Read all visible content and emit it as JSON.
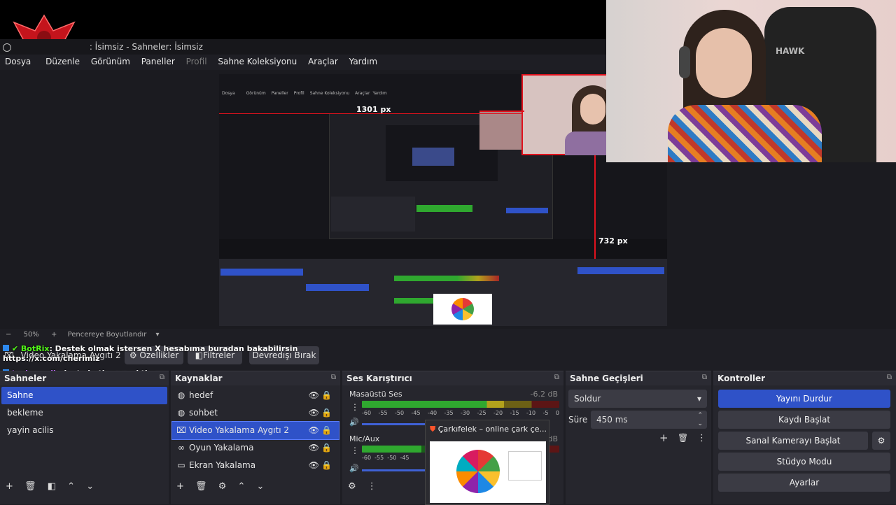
{
  "window": {
    "title": "OBS Studio - Profil: İsimsiz - Sahneler: İsimsiz",
    "title_visible": ": İsimsiz - Sahneler: İsimsiz"
  },
  "menu": [
    "Dosya",
    "Düzenle",
    "Görünüm",
    "Paneller",
    "Profil",
    "Sahne Koleksiyonu",
    "Araçlar",
    "Yardım"
  ],
  "preview": {
    "width_label": "1301 px",
    "height_label": "732 px",
    "zoom": "50%",
    "fit_label": "Pencereye Boyutlandır"
  },
  "chat": [
    {
      "user": "BotRix",
      "message": ": Destek olmak istersen X hesabıma buradan bakabilirsin"
    },
    {
      "user": "",
      "message": "https://x.com/cherimiz"
    },
    {
      "user": "technoerik",
      "message": ": just chating e cektim"
    }
  ],
  "toolbar": {
    "source_name": "Video Yakalama Aygıtı 2",
    "properties": "Özellikler",
    "filters": "Filtreler",
    "deactivate": "Devredışı Bırak"
  },
  "scenes": {
    "title": "Sahneler",
    "items": [
      "Sahne",
      "bekleme",
      "yayin acilis"
    ]
  },
  "sources": {
    "title": "Kaynaklar",
    "items": [
      {
        "name": "hedef",
        "icon": "globe-icon"
      },
      {
        "name": "sohbet",
        "icon": "globe-icon"
      },
      {
        "name": "Video Yakalama Aygıtı 2",
        "icon": "camera-icon"
      },
      {
        "name": "Oyun Yakalama",
        "icon": "gamepad-icon"
      },
      {
        "name": "Ekran Yakalama",
        "icon": "monitor-icon"
      }
    ]
  },
  "mixer": {
    "title": "Ses Karıştırıcı",
    "channels": [
      {
        "name": "Masaüstü Ses",
        "db": "-6.2 dB",
        "level": 0.72
      },
      {
        "name": "Mic/Aux",
        "db": "dB",
        "level": 0.3
      }
    ],
    "scale": [
      "-60",
      "-55",
      "-50",
      "-45",
      "-40",
      "-35",
      "-30",
      "-25",
      "-20",
      "-15",
      "-10",
      "-5",
      "0"
    ]
  },
  "browser_popup": {
    "title": "Çarkıfelek – online çark çe..."
  },
  "transitions": {
    "title": "Sahne Geçişleri",
    "selected": "Soldur",
    "duration_label": "Süre",
    "duration": "450 ms"
  },
  "controls": {
    "title": "Kontroller",
    "buttons": [
      "Yayını Durdur",
      "Kaydı Başlat",
      "Sanal Kamerayı Başlat",
      "Stüdyo Modu",
      "Ayarlar"
    ]
  },
  "colors": {
    "accent": "#2f52c8",
    "selection_red": "#e0121d",
    "meter_green": "#2fa82f",
    "meter_yellow": "#b2a11c",
    "meter_red": "#a82626"
  }
}
